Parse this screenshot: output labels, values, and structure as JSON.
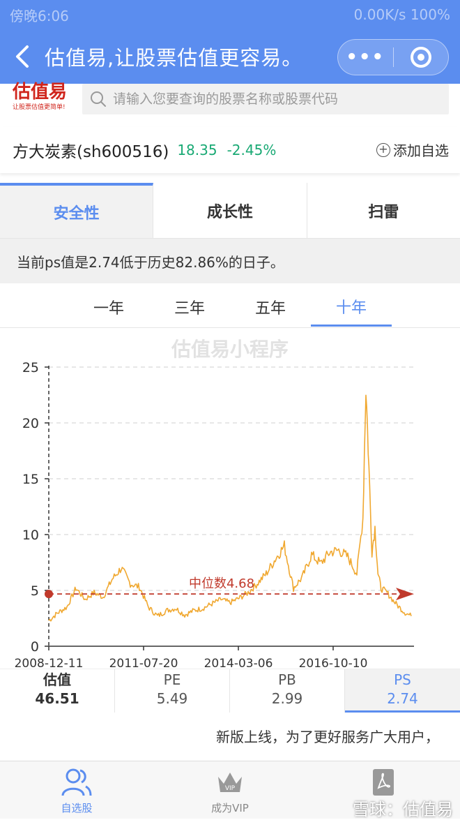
{
  "status_bar": {
    "left": "傍晚6:06",
    "right": "0.00K/s  100%"
  },
  "nav": {
    "back_icon": "chevron-left-icon",
    "title": "估值易,让股票估值更容易。",
    "more_icon": "more-dots-icon",
    "close_icon": "target-circle-icon",
    "more_label": "•••"
  },
  "logo": {
    "main": "估值易",
    "sub": "让股票估值更简单!"
  },
  "search": {
    "placeholder": "请输入您要查询的股票名称或股票代码"
  },
  "stock": {
    "name": "方大炭素(sh600516)",
    "price": "18.35",
    "change": "-2.45%",
    "add_fav": "添加自选",
    "colors": {
      "down": "#19a974"
    }
  },
  "tabs": [
    {
      "label": "安全性",
      "active": true
    },
    {
      "label": "成长性",
      "active": false
    },
    {
      "label": "扫雷",
      "active": false
    }
  ],
  "info": {
    "text": "当前ps值是2.74低于历史82.86%的日子。"
  },
  "periods": [
    {
      "label": "一年"
    },
    {
      "label": "三年"
    },
    {
      "label": "五年"
    },
    {
      "label": "十年",
      "active": true
    }
  ],
  "chart_data": {
    "type": "line",
    "watermark": "估值易小程序",
    "ylim": [
      0,
      25
    ],
    "y_ticks": [
      "0",
      "5",
      "10",
      "15",
      "20",
      "25"
    ],
    "x_ticks": [
      "2008-12-11",
      "2011-07-20",
      "2014-03-06",
      "2016-10-10"
    ],
    "series": [
      {
        "name": "PS",
        "color": "#f0a830",
        "x": [
          "2008-12",
          "2009-03",
          "2009-06",
          "2009-09",
          "2009-12",
          "2010-03",
          "2010-06",
          "2010-09",
          "2010-12",
          "2011-03",
          "2011-06",
          "2011-09",
          "2011-12",
          "2012-03",
          "2012-06",
          "2012-09",
          "2012-12",
          "2013-03",
          "2013-06",
          "2013-09",
          "2013-12",
          "2014-03",
          "2014-06",
          "2014-09",
          "2014-12",
          "2015-03",
          "2015-06",
          "2015-09",
          "2015-12",
          "2016-03",
          "2016-06",
          "2016-09",
          "2016-12",
          "2017-03",
          "2017-06",
          "2017-08",
          "2017-09",
          "2017-10",
          "2017-11",
          "2017-12",
          "2018-01",
          "2018-02",
          "2018-04",
          "2018-06",
          "2018-08",
          "2018-10",
          "2018-12"
        ],
        "values": [
          2.3,
          3.0,
          3.5,
          5.2,
          4.2,
          4.8,
          4.4,
          6.0,
          7.0,
          5.6,
          5.3,
          3.5,
          2.7,
          3.2,
          3.4,
          2.8,
          3.2,
          3.4,
          3.8,
          4.2,
          3.9,
          4.3,
          4.8,
          5.6,
          6.5,
          7.8,
          9.0,
          5.2,
          6.2,
          8.2,
          7.4,
          8.4,
          8.6,
          8.0,
          6.5,
          11.5,
          23.2,
          16.0,
          8.5,
          10.6,
          6.5,
          5.2,
          4.8,
          4.1,
          3.5,
          3.0,
          2.7
        ]
      }
    ],
    "median": {
      "label": "中位数4.68",
      "value": 4.68,
      "color": "#c0392b"
    },
    "grid": true
  },
  "metrics": [
    {
      "label": "估值",
      "value": "46.51",
      "bold": true
    },
    {
      "label": "PE",
      "value": "5.49"
    },
    {
      "label": "PB",
      "value": "2.99"
    },
    {
      "label": "PS",
      "value": "2.74",
      "active": true
    }
  ],
  "notice": "新版上线，为了更好服务广大用户，",
  "bottom_nav": [
    {
      "label": "自选股",
      "icon": "users-icon",
      "active": true
    },
    {
      "label": "成为VIP",
      "icon": "crown-icon"
    },
    {
      "label": "",
      "icon": "pdf-icon"
    }
  ],
  "watermark": "雪球：估值易"
}
